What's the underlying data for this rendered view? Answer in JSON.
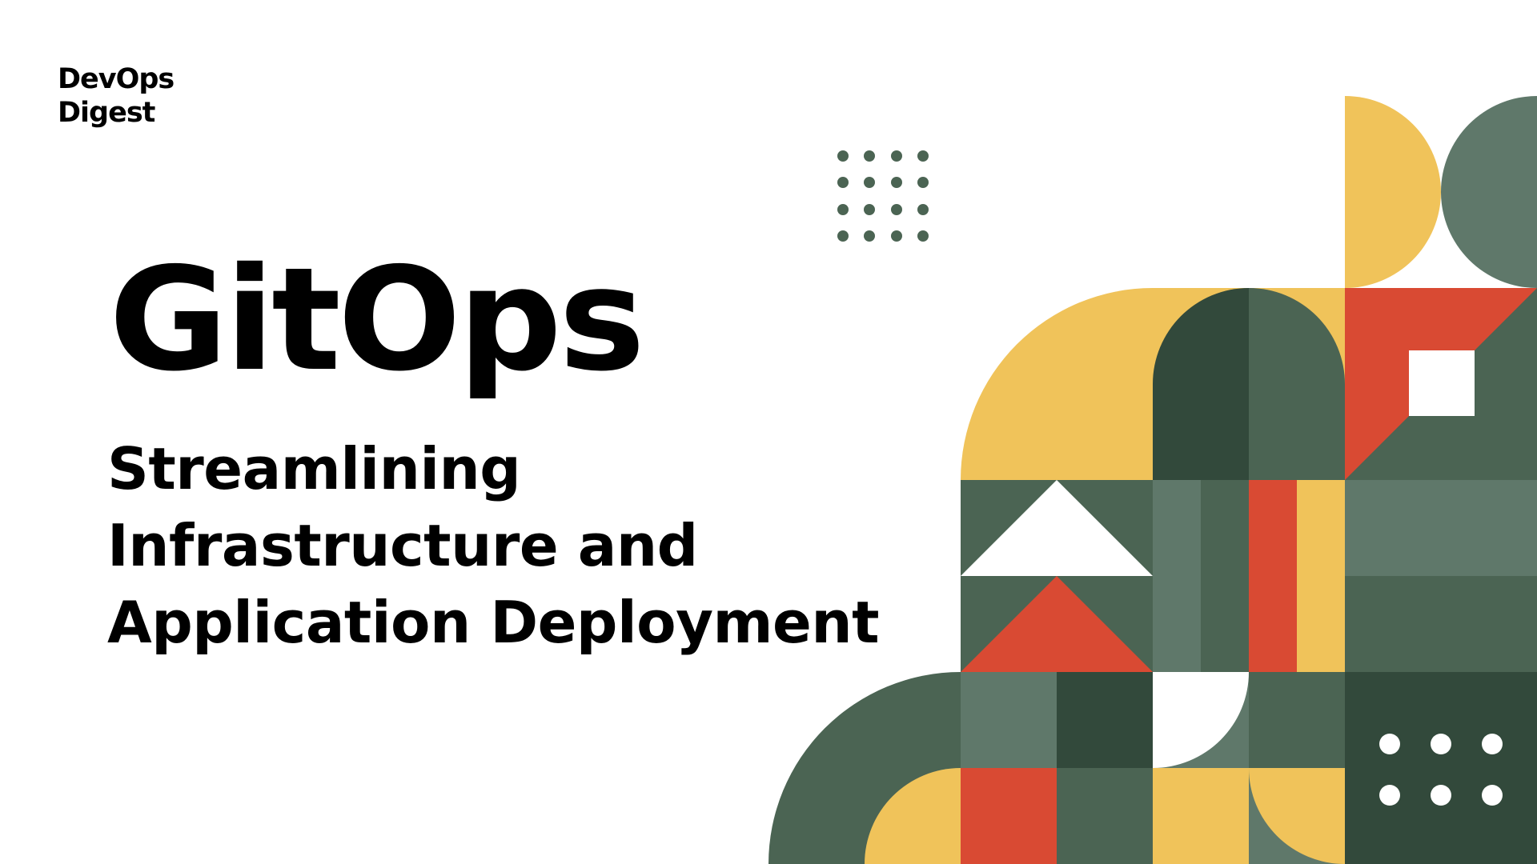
{
  "brand": {
    "line1": "DevOps",
    "line2": "Digest"
  },
  "title": "GitOps",
  "subtitle": {
    "line1": "Streamlining",
    "line2": "Infrastructure and",
    "line3": "Application Deployment"
  },
  "colors": {
    "yellow": "#f0c35a",
    "sage": "#5f786a",
    "green": "#4b6453",
    "dark_green": "#32493b",
    "red": "#d94a33",
    "white": "#ffffff",
    "dot": "#4b6453"
  }
}
